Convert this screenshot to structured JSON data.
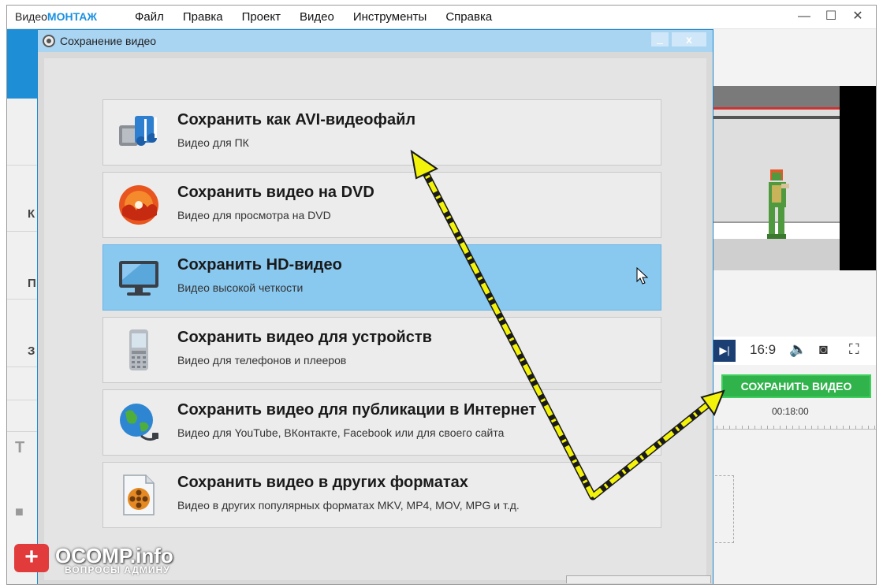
{
  "app": {
    "logo_prefix": "Видео",
    "logo_accent": "МОНТАЖ",
    "menu": [
      "Файл",
      "Правка",
      "Проект",
      "Видео",
      "Инструменты",
      "Справка"
    ],
    "window_controls": {
      "minimize": "—",
      "maximize": "☐",
      "close": "✕"
    }
  },
  "left_panel": {
    "letters": [
      "К",
      "П",
      "З"
    ]
  },
  "dialog": {
    "title": "Сохранение видео",
    "minimize": "_",
    "close": "x",
    "options": [
      {
        "title": "Сохранить как AVI-видеофайл",
        "subtitle": "Видео для ПК",
        "icon": "music-file-icon"
      },
      {
        "title": "Сохранить видео на DVD",
        "subtitle": "Видео для просмотра на DVD",
        "icon": "dvd-disc-icon"
      },
      {
        "title": "Сохранить HD-видео",
        "subtitle": "Видео высокой четкости",
        "icon": "monitor-icon",
        "selected": true
      },
      {
        "title": "Сохранить видео для устройств",
        "subtitle": "Видео для телефонов и плееров",
        "icon": "phone-icon"
      },
      {
        "title": "Сохранить видео для публикации в Интернет",
        "subtitle": "Видео для YouTube, ВКонтакте, Facebook или для своего сайта",
        "icon": "globe-icon"
      },
      {
        "title": "Сохранить видео в других форматах",
        "subtitle": "Видео в других популярных форматах MKV, MP4, MOV, MPG и т.д.",
        "icon": "film-reel-icon"
      }
    ]
  },
  "player": {
    "aspect_ratio": "16:9",
    "save_button": "СОХРАНИТЬ ВИДЕО",
    "timecode": "00:18:00"
  },
  "watermark": {
    "text": "OCOMP.info",
    "subtext": "ВОПРОСЫ АДМИНУ"
  },
  "colors": {
    "selected_bg": "#89c8ef",
    "save_green": "#2fb34a",
    "arrow_yellow": "#f2f20a",
    "title_blue": "#a9d4f2"
  }
}
